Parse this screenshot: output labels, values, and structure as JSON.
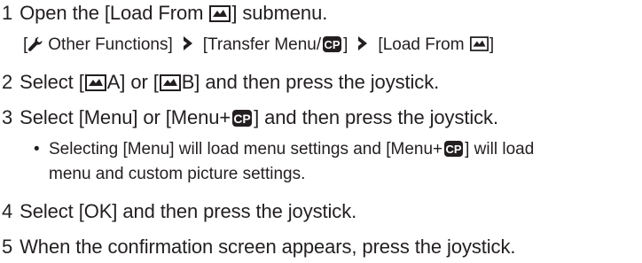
{
  "steps": [
    {
      "number": "1",
      "pre": "Open the [Load From ",
      "card_icon": "memory-card-icon",
      "post": "] submenu."
    },
    {
      "number": "2",
      "t1": "Select [",
      "t2": "A] or [",
      "t3": "B] and then press the joystick."
    },
    {
      "number": "3",
      "t1": "Select [Menu] or [Menu+",
      "cp_icon": "custom-picture-icon",
      "t2": "] and then press the joystick."
    },
    {
      "number": "4",
      "text": "Select [OK] and then press the joystick."
    },
    {
      "number": "5",
      "text": "When the confirmation screen appears, press the joystick."
    }
  ],
  "path": {
    "open_bracket": "[",
    "wrench_icon": "wrench-icon",
    "item1": "Other Functions]",
    "arrow_icon": "arrow-right-icon",
    "item2_pre": "[Transfer Menu/",
    "item2_post": "]",
    "item3_pre": "[Load From ",
    "item3_post": "]"
  },
  "note": {
    "line1_pre": "Selecting [Menu] will load menu settings and [Menu+",
    "line1_post": "] will load",
    "line2": "menu and custom picture settings."
  },
  "colors": {
    "text": "#231f20",
    "icon_fill": "#231f20"
  }
}
